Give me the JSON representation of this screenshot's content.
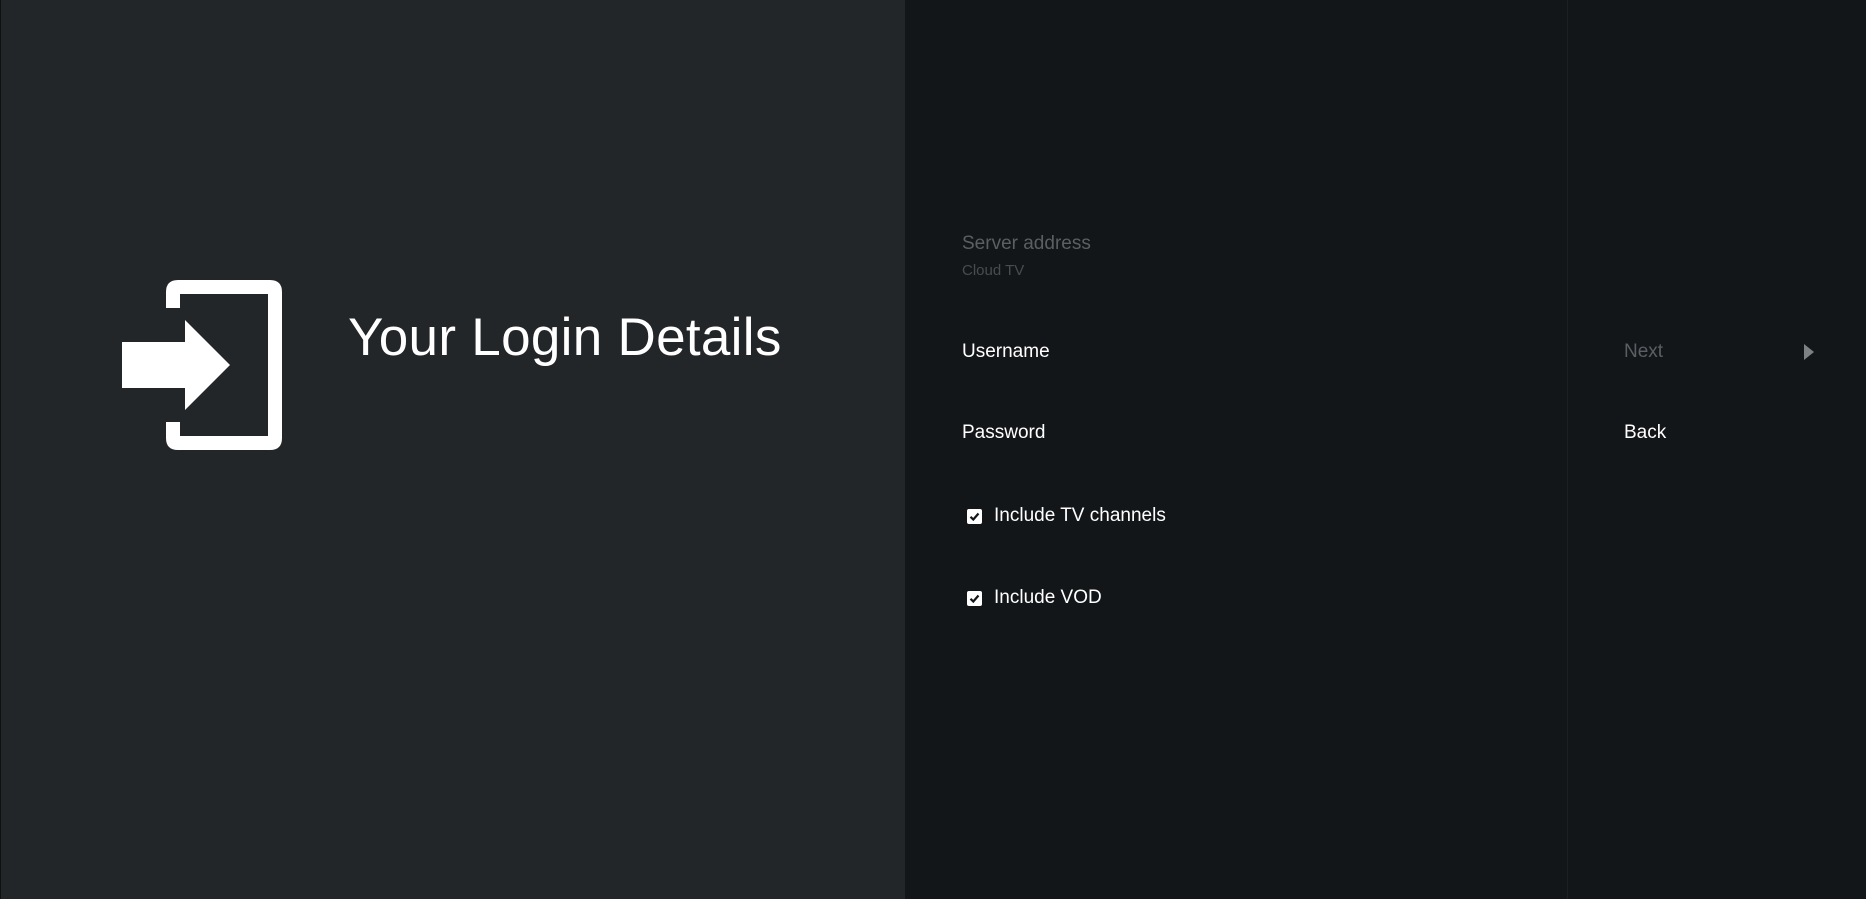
{
  "guidance": {
    "title": "Your Login Details",
    "icon": "login-icon"
  },
  "form": {
    "server": {
      "title": "Server address",
      "description": "Cloud TV"
    },
    "username": {
      "title": "Username"
    },
    "password": {
      "title": "Password"
    },
    "include_tv": {
      "label": "Include TV channels",
      "checked": true
    },
    "include_vod": {
      "label": "Include VOD",
      "checked": true
    }
  },
  "actions": {
    "next": {
      "label": "Next",
      "icon": "chevron-right-icon",
      "enabled": false
    },
    "back": {
      "label": "Back",
      "enabled": true
    }
  },
  "colors": {
    "left_panel_bg": "#222629",
    "right_panel_bg": "#131619",
    "text_primary": "#ffffff",
    "text_disabled": "#5a5f63"
  }
}
